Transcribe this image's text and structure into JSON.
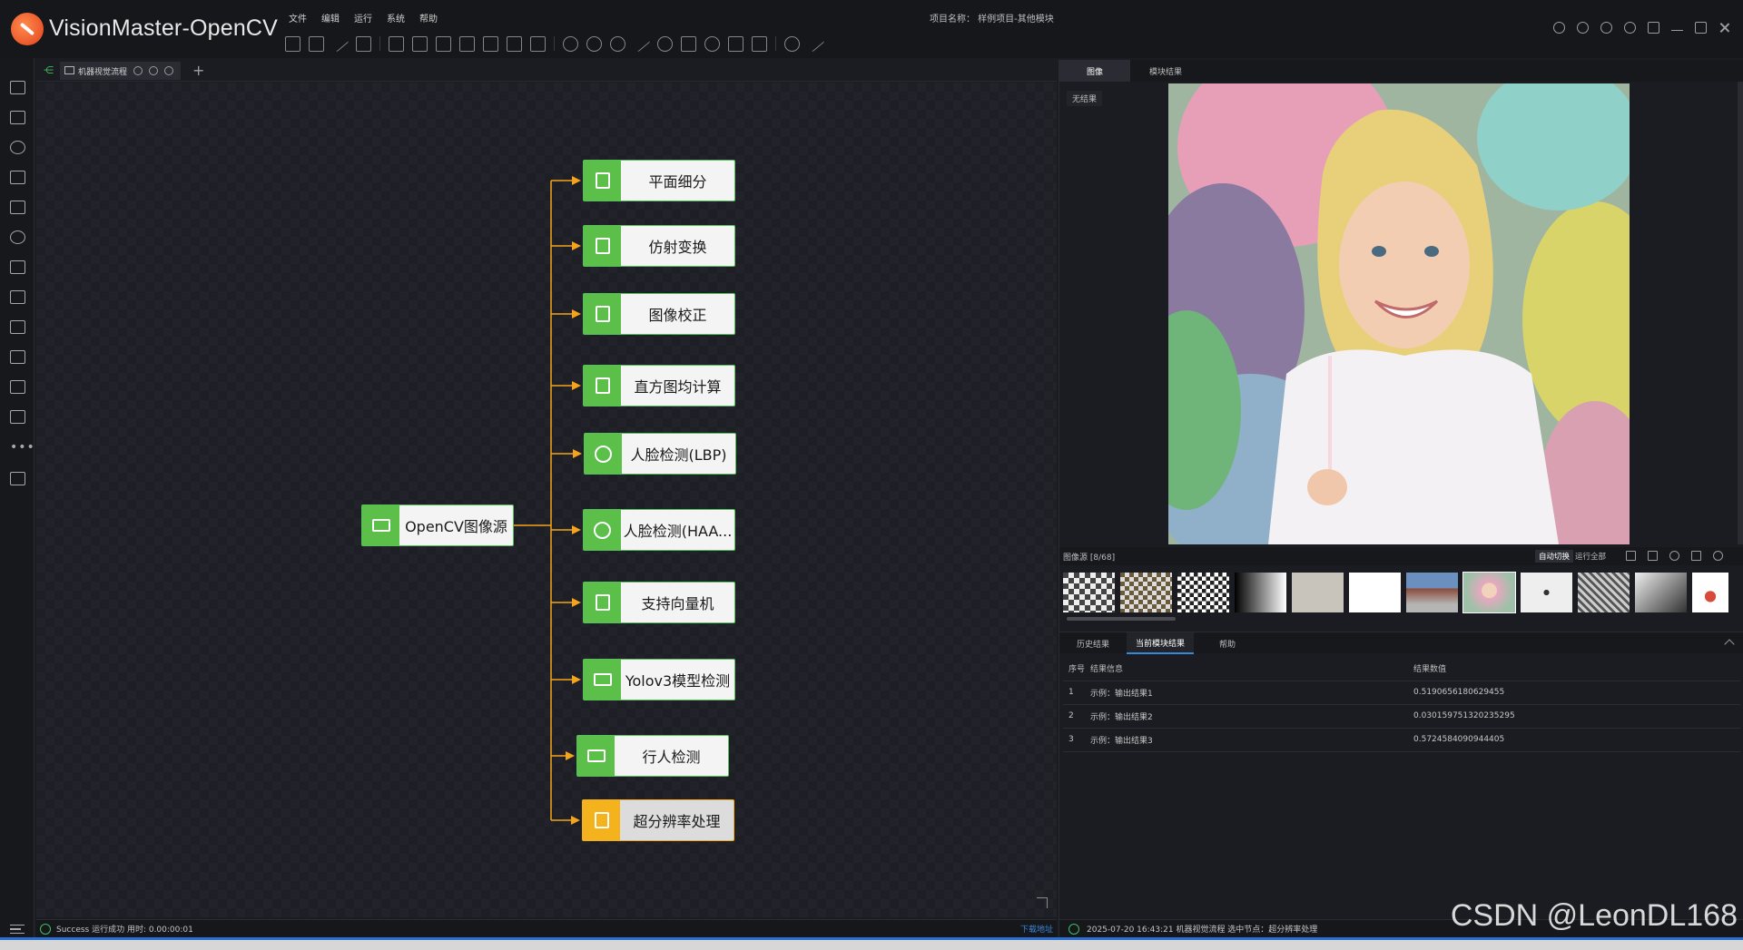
{
  "app": {
    "title": "VisionMaster-OpenCV",
    "menu": [
      "文件",
      "编辑",
      "运行",
      "系统",
      "帮助"
    ],
    "project_name": "项目名称： 样例项目-其他模块"
  },
  "flow": {
    "tab_label": "机器视觉流程",
    "source_node": "OpenCV图像源",
    "nodes": [
      {
        "label": "平面细分",
        "icon": "clipboard-icon"
      },
      {
        "label": "仿射变换",
        "icon": "clipboard-icon"
      },
      {
        "label": "图像校正",
        "icon": "clipboard-icon"
      },
      {
        "label": "直方图均计算",
        "icon": "clipboard-icon"
      },
      {
        "label": "人脸检测(LBP)",
        "icon": "face-icon"
      },
      {
        "label": "人脸检测(HAA...",
        "icon": "face-icon"
      },
      {
        "label": "支持向量机",
        "icon": "person-scan-icon"
      },
      {
        "label": "Yolov3模型检测",
        "icon": "detector-icon"
      },
      {
        "label": "行人检测",
        "icon": "monitor-icon"
      },
      {
        "label": "超分辨率处理",
        "icon": "person-scan-icon"
      }
    ],
    "colors": {
      "node_green": "#5cbf4a",
      "selected": "#f4b21c",
      "link": "#f3a31c"
    }
  },
  "status_left": {
    "text": "Success 运行成功 用时: 0.00:00:01",
    "link": "下载地址"
  },
  "image_panel": {
    "tabs": [
      "图像",
      "模块结果"
    ],
    "no_result": "无结果"
  },
  "thumbnails": {
    "source_label": "图像源 [8/68]",
    "auto_switch": "自动切换",
    "run_all": "运行全部"
  },
  "results": {
    "tabs": [
      "历史结果",
      "当前模块结果",
      "帮助"
    ],
    "columns": [
      "序号",
      "结果信息",
      "结果数值"
    ],
    "rows": [
      [
        "1",
        "示例：输出结果1",
        "0.5190656180629455"
      ],
      [
        "2",
        "示例：输出结果2",
        "0.030159751320235295"
      ],
      [
        "3",
        "示例：输出结果3",
        "0.5724584090944405"
      ]
    ]
  },
  "status_right": {
    "text": "2025-07-20 16:43:21  机器视觉流程 选中节点：超分辨率处理"
  },
  "watermark": "CSDN @LeonDL168"
}
